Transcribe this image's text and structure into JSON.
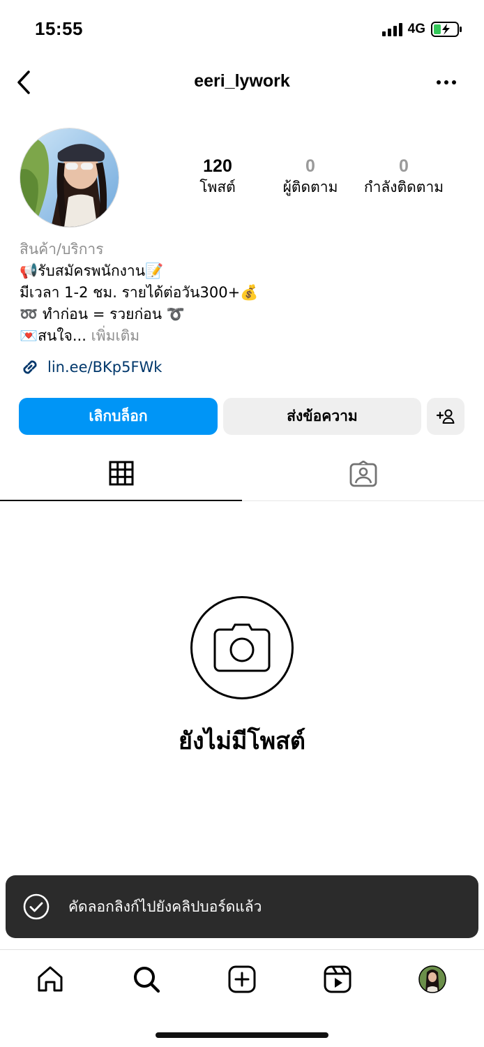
{
  "status_bar": {
    "time": "15:55",
    "network": "4G"
  },
  "header": {
    "username": "eeri_lywork"
  },
  "stats": [
    {
      "value": "120",
      "label": "โพสต์"
    },
    {
      "value": "0",
      "label": "ผู้ติดตาม"
    },
    {
      "value": "0",
      "label": "กำลังติดตาม"
    }
  ],
  "bio": {
    "category": "สินค้า/บริการ",
    "line1": "📢รับสมัครพนักงาน📝",
    "line2": "มีเวลา 1-2 ชม. รายได้ต่อวัน300+💰",
    "line3": "➿ ทำก่อน = รวยก่อน ➰",
    "line4": "💌สนใจ...",
    "more": " เพิ่มเติม"
  },
  "link": {
    "text": "lin.ee/BKp5FWk"
  },
  "buttons": {
    "unblock": "เลิกบล็อก",
    "message": "ส่งข้อความ"
  },
  "tabs": {
    "grid_icon": "grid-icon",
    "tagged_icon": "tagged-person-icon"
  },
  "empty_state": {
    "title": "ยังไม่มีโพสต์"
  },
  "toast": {
    "message": "คัดลอกลิงก์ไปยังคลิปบอร์ดแล้ว"
  },
  "bottom_nav": [
    "home-icon",
    "search-icon",
    "create-icon",
    "reels-icon",
    "profile-avatar"
  ],
  "colors": {
    "primary_button": "#0095f6",
    "link": "#00376b",
    "toast_bg": "#2b2b2b"
  }
}
